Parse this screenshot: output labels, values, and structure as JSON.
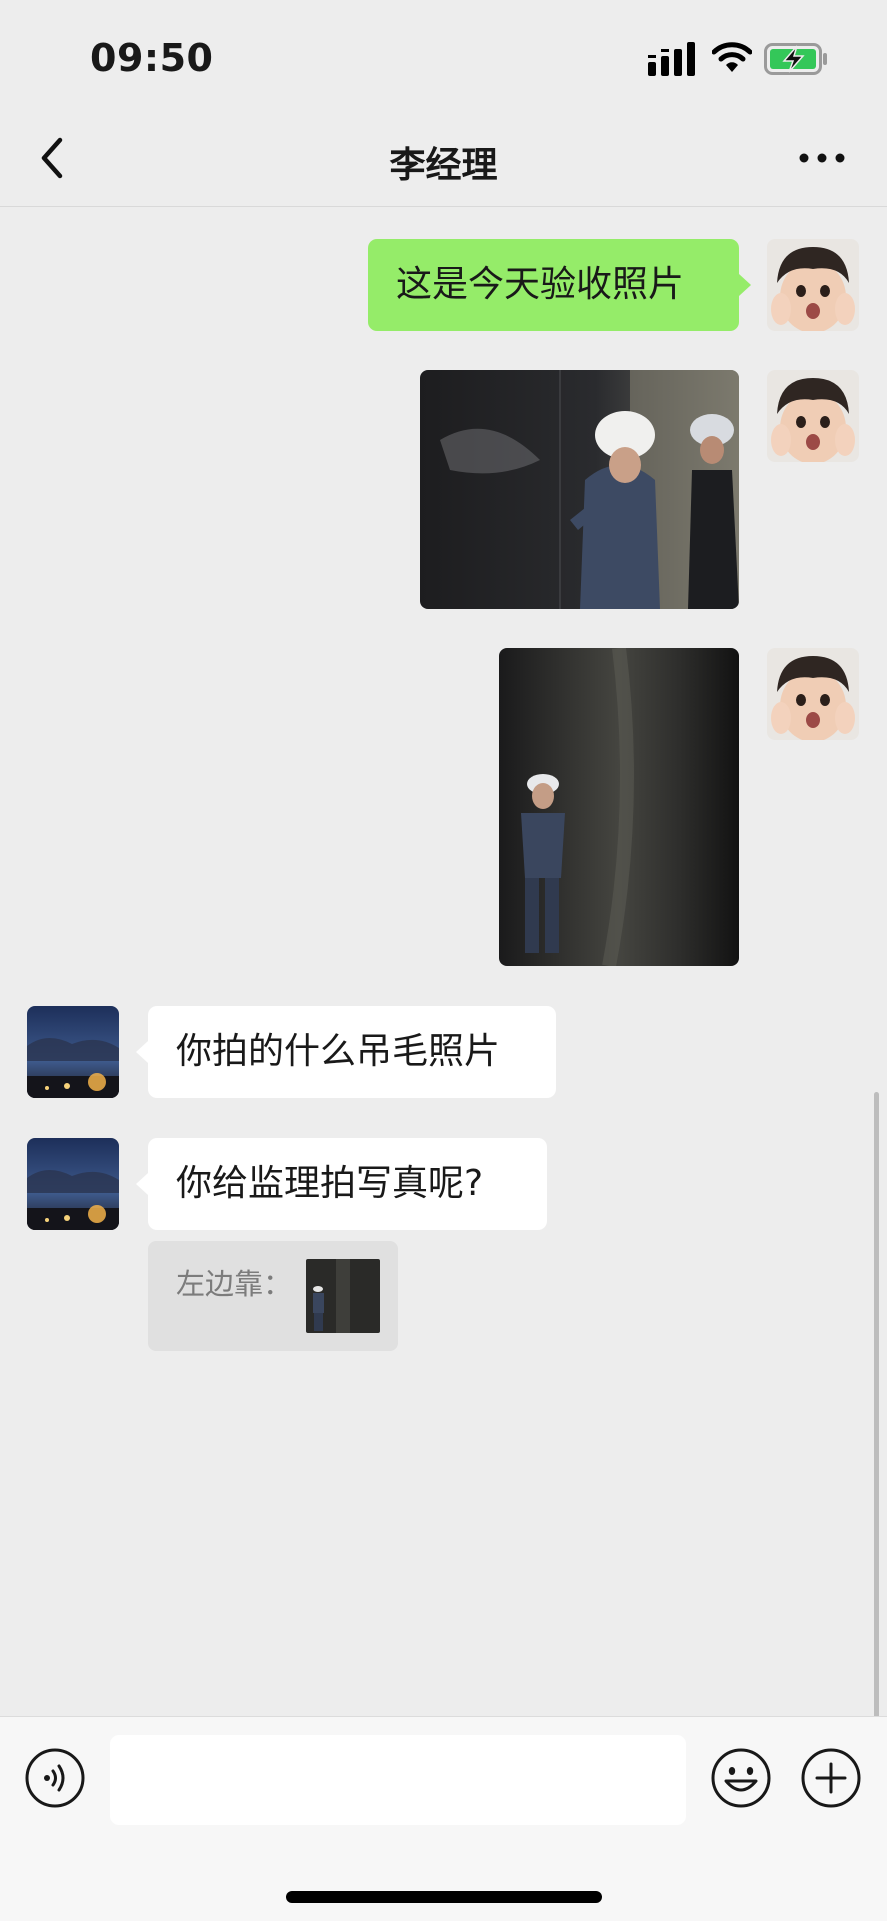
{
  "status_bar": {
    "time": "09:50",
    "icons": [
      "signal-icon",
      "wifi-icon",
      "battery-charging-icon"
    ]
  },
  "nav": {
    "title": "李经理",
    "back_icon": "chevron-left-icon",
    "more_icon": "more-dots-icon"
  },
  "messages": [
    {
      "side": "right",
      "type": "text",
      "text": "这是今天验收照片"
    },
    {
      "side": "right",
      "type": "image"
    },
    {
      "side": "right",
      "type": "image"
    },
    {
      "side": "left",
      "type": "text",
      "text": "你拍的什么吊毛照片"
    },
    {
      "side": "left",
      "type": "text",
      "text": "你给监理拍写真呢?"
    }
  ],
  "quote": {
    "text": "左边靠："
  },
  "input_bar": {
    "placeholder": "",
    "icons": [
      "voice-icon",
      "emoji-icon",
      "plus-icon"
    ]
  },
  "colors": {
    "outgoing_bubble": "#95ec69",
    "incoming_bubble": "#ffffff",
    "background": "#ededed"
  }
}
